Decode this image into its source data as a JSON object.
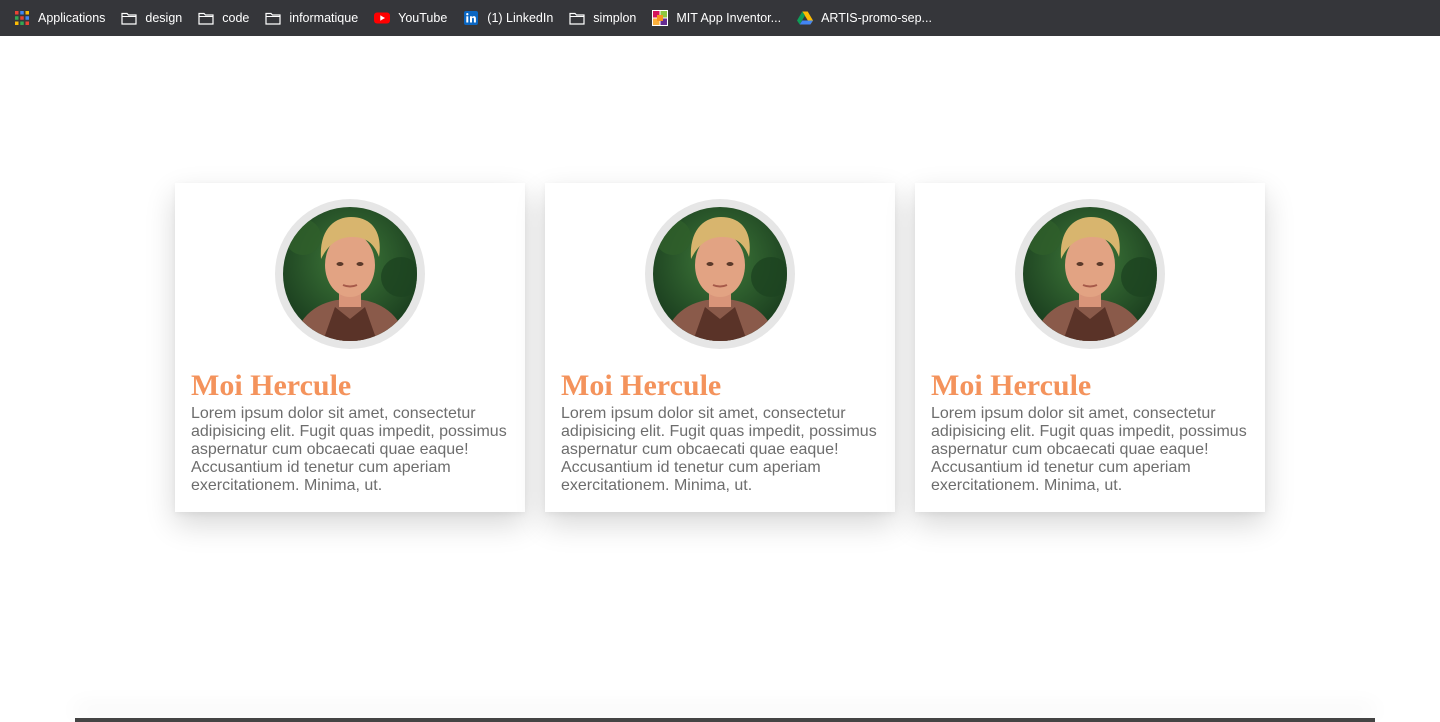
{
  "bookmarks": [
    {
      "label": "Applications",
      "icon": "apps-grid-icon"
    },
    {
      "label": "design",
      "icon": "folder-icon"
    },
    {
      "label": "code",
      "icon": "folder-icon"
    },
    {
      "label": "informatique",
      "icon": "folder-icon"
    },
    {
      "label": "YouTube",
      "icon": "youtube-icon"
    },
    {
      "label": "(1) LinkedIn",
      "icon": "linkedin-icon"
    },
    {
      "label": "simplon",
      "icon": "folder-icon"
    },
    {
      "label": "MIT App Inventor...",
      "icon": "app-inventor-icon"
    },
    {
      "label": "ARTIS-promo-sep...",
      "icon": "google-drive-icon"
    }
  ],
  "cards": [
    {
      "title": "Moi Hercule",
      "text": "Lorem ipsum dolor sit amet, consectetur adipisicing elit. Fugit quas impedit, possimus aspernatur cum obcaecati quae eaque! Accusantium id tenetur cum aperiam exercitationem. Minima, ut."
    },
    {
      "title": "Moi Hercule",
      "text": "Lorem ipsum dolor sit amet, consectetur adipisicing elit. Fugit quas impedit, possimus aspernatur cum obcaecati quae eaque! Accusantium id tenetur cum aperiam exercitationem. Minima, ut."
    },
    {
      "title": "Moi Hercule",
      "text": "Lorem ipsum dolor sit amet, consectetur adipisicing elit. Fugit quas impedit, possimus aspernatur cum obcaecati quae eaque! Accusantium id tenetur cum aperiam exercitationem. Minima, ut."
    }
  ],
  "colors": {
    "bookmarks_bar_bg": "#35363a",
    "title_accent": "#f4935c",
    "body_text": "#6d6d6d",
    "avatar_ring": "#e6e6e6"
  }
}
